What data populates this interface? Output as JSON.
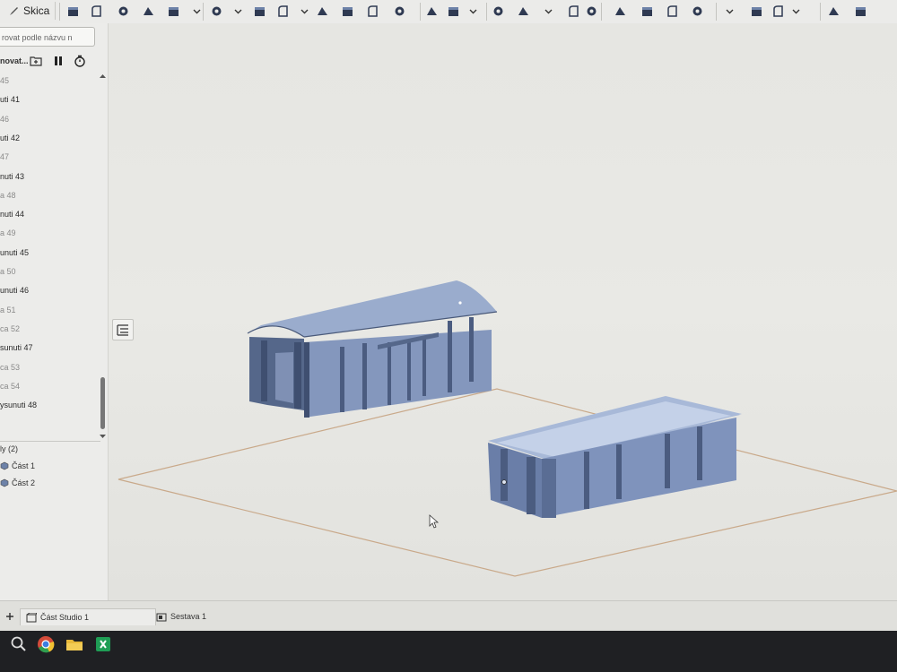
{
  "toolbar": {
    "sketch_label": "Skica",
    "icons": [
      "extrude-icon",
      "revolve-icon",
      "sweep-icon",
      "loft-icon",
      "thicken-icon",
      "chevron-down-icon",
      "fillet-icon",
      "chevron-down-icon",
      "chamfer-icon",
      "draft-icon",
      "chevron-down-icon",
      "shell-icon",
      "hole-icon",
      "fillet-hole-icon",
      "cylinder-icon",
      "boolean-icon",
      "split-icon",
      "chevron-down-icon",
      "transform-icon",
      "pattern-icon",
      "chevron-down-icon",
      "mirror-icon",
      "delete-icon",
      "move-face-icon",
      "replace-face-icon",
      "offset-surface-icon",
      "plane-icon",
      "chevron-down-icon",
      "mate-connector-icon",
      "list-icon",
      "chevron-down-icon",
      "clock-icon",
      "code-icon"
    ]
  },
  "feature_panel": {
    "search_placeholder": "rovat podle názvu n",
    "header_label": "novat...",
    "scroll_up_icon": "chevron-up-icon",
    "scroll_down_icon": "chevron-down-icon",
    "features": [
      {
        "label": "45",
        "style": "light"
      },
      {
        "label": "uti 41",
        "style": "dark"
      },
      {
        "label": "46",
        "style": "light"
      },
      {
        "label": "uti 42",
        "style": "dark"
      },
      {
        "label": "47",
        "style": "light"
      },
      {
        "label": "nuti 43",
        "style": "dark"
      },
      {
        "label": "a 48",
        "style": "light"
      },
      {
        "label": "nuti 44",
        "style": "dark"
      },
      {
        "label": "a 49",
        "style": "light"
      },
      {
        "label": "unuti 45",
        "style": "dark"
      },
      {
        "label": "a 50",
        "style": "light"
      },
      {
        "label": "unuti 46",
        "style": "dark"
      },
      {
        "label": "a 51",
        "style": "light"
      },
      {
        "label": "ca 52",
        "style": "light"
      },
      {
        "label": "sunuti 47",
        "style": "dark"
      },
      {
        "label": "ca 53",
        "style": "light"
      },
      {
        "label": "ca 54",
        "style": "light"
      },
      {
        "label": "ysunuti 48",
        "style": "dark"
      }
    ],
    "parts_header": "ly (2)",
    "parts": [
      "Část 1",
      "Část 2"
    ]
  },
  "viewport": {
    "cursor_icon": "mouse-pointer-icon",
    "panel_toggle_icon": "list-icon"
  },
  "tabs": {
    "add_icon": "plus-icon",
    "items": [
      {
        "label": "Část Studio 1",
        "icon": "part-studio-icon",
        "active": true
      },
      {
        "label": "Sestava 1",
        "icon": "assembly-icon",
        "active": false
      }
    ]
  },
  "taskbar": {
    "icons": [
      "search-icon",
      "chrome-icon",
      "file-explorer-icon",
      "spreadsheet-icon"
    ]
  },
  "colors": {
    "model_face": "#8a9fc4",
    "model_dark": "#4d5f82",
    "plane_edge": "#c9a98a",
    "taskbar": "#1f2023"
  }
}
